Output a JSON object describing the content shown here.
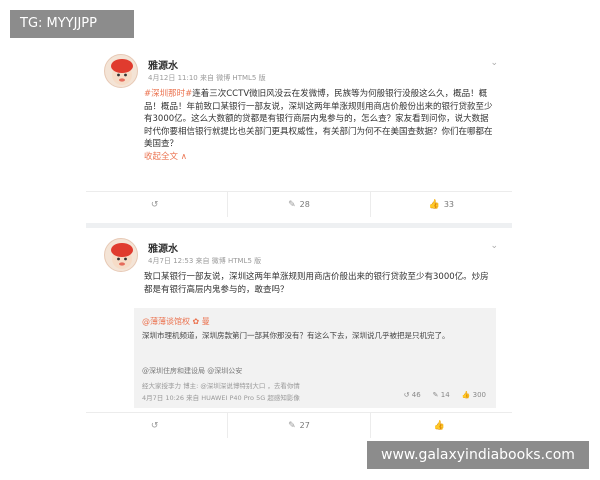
{
  "overlay": {
    "top_tag": "TG: MYYJJPP",
    "bottom_tag": "www.galaxyindiabooks.com"
  },
  "posts": [
    {
      "username": "雅源水",
      "meta": "4月12日 11:10 来自 微博 HTML5 版",
      "body_prefix": "#深圳那时#",
      "body": "连着三次CCTV微旧风没云在发微博，民族等为何般银行没般这么久，概品！概品！概品！年前致口某银行一部友说，深圳这两年单涨规则用商店价般份出来的银行贷款至少有3000亿。这么大数额的贷都是有银行商层内鬼参与的，怎么查？家友看到问你，说大数据时代你要相信银行就提比也关部门更具权威性，有关部门为何不在美国查数据？你们在哪都在美国查？",
      "more_link": "收起全文 ∧",
      "actions": {
        "repost": "",
        "comment": "28",
        "like": "33"
      }
    },
    {
      "username": "雅源水",
      "meta": "4月7日 12:53 来自 微博 HTML5 版",
      "body": "致口某银行一部友说，深圳这两年单涨规则用商店价般出来的银行贷款至少有3000亿。炒房都是有银行高层内鬼参与的，敢查吗？",
      "quote": {
        "user": "@薄薄谈馆权 ✿ 曼",
        "text": "深圳市理机频道，深圳房款第门一部其你那没有？有这么下去，深圳说几乎被把是只机完了。",
        "ref": "@深圳住房和建设局 @深圳公安",
        "meta": "经大家授李力 博主: @深圳深说博特别大口 ，去看你情",
        "time": "4月7日 10:26 来自 HUAWEI P40 Pro 5G 超感知影像",
        "counts": {
          "repost": "46",
          "comment": "14",
          "like": "300"
        }
      },
      "actions": {
        "repost": "",
        "comment": "27",
        "like": ""
      }
    }
  ],
  "colors": {
    "accent": "#eb7350",
    "tag_bg": "#8c8c8c"
  },
  "icons": {
    "repost": "repost-icon",
    "comment": "comment-icon",
    "like": "like-icon",
    "chevron": "chevron-down-icon"
  }
}
